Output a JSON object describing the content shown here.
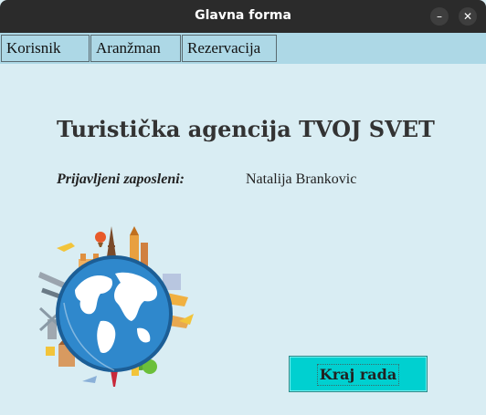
{
  "window": {
    "title": "Glavna forma",
    "minimize_glyph": "–",
    "close_glyph": "✕"
  },
  "menu": {
    "items": [
      {
        "label": "Korisnik"
      },
      {
        "label": "Aranžman"
      },
      {
        "label": "Rezervacija"
      }
    ]
  },
  "main": {
    "heading": "Turistička agencija TVOJ SVET",
    "employee_label": "Prijavljeni zaposleni:",
    "employee_name": "Natalija Brankovic"
  },
  "illustration": {
    "icon": "globe-landmarks-illustration"
  },
  "buttons": {
    "exit_label": "Kraj rada"
  },
  "colors": {
    "background": "#d9edf3",
    "menubar": "#add8e6",
    "exit_button": "#00d0d0",
    "titlebar": "#2b2b2b"
  }
}
